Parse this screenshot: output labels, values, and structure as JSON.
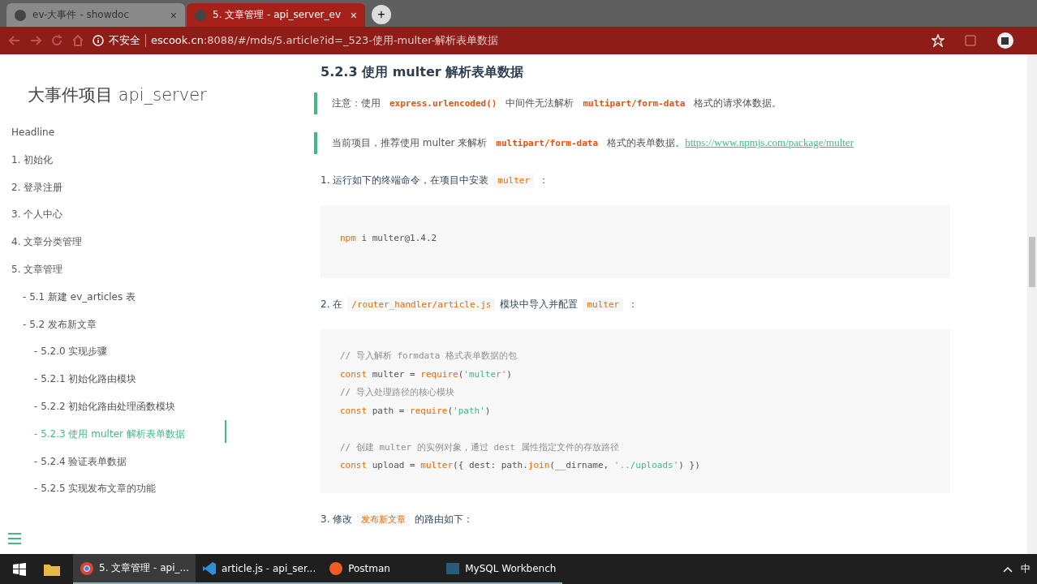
{
  "browser": {
    "tabs": [
      {
        "title": "ev-大事件 - showdoc",
        "selected": false,
        "close": "×"
      },
      {
        "title": "5. 文章管理 - api_server_ev",
        "selected": true,
        "close": "×"
      }
    ],
    "new_tab": "+",
    "security": "不安全",
    "url_host": "escook.cn",
    "url_rest": ":8088/#/mds/5.article?id=_523-使用-multer-解析表单数据"
  },
  "sidebar": {
    "title": "大事件项目 api_server",
    "toc": [
      {
        "label": "Headline",
        "selected": false
      },
      {
        "label": "1. 初始化",
        "selected": false
      },
      {
        "label": "2. 登录注册",
        "selected": false
      },
      {
        "label": "3. 个人中心",
        "selected": false
      },
      {
        "label": "4. 文章分类管理",
        "selected": false
      },
      {
        "label": "5. 文章管理",
        "selected": false,
        "children": [
          {
            "label": "- 5.1 新建 ev_articles 表",
            "selected": false
          },
          {
            "label": "- 5.2 发布新文章",
            "selected": false,
            "children": [
              {
                "label": "- 5.2.0 实现步骤",
                "selected": false
              },
              {
                "label": "- 5.2.1 初始化路由模块",
                "selected": false
              },
              {
                "label": "- 5.2.2 初始化路由处理函数模块",
                "selected": false
              },
              {
                "label": "- 5.2.3 使用 multer 解析表单数据",
                "selected": true
              },
              {
                "label": "- 5.2.4 验证表单数据",
                "selected": false
              },
              {
                "label": "- 5.2.5 实现发布文章的功能",
                "selected": false
              }
            ]
          }
        ]
      }
    ]
  },
  "article": {
    "heading": "5.2.3 使用 multer 解析表单数据",
    "blocks": [
      {
        "kind": "quote",
        "parts": [
          {
            "kind": "text",
            "text": "注意：使用"
          },
          {
            "kind": "code",
            "text": "express.urlencoded()"
          },
          {
            "kind": "text",
            "text": "中间件无法解析"
          },
          {
            "kind": "code",
            "text": "multipart/form-data"
          },
          {
            "kind": "text",
            "text": "格式的请求体数据。"
          }
        ]
      },
      {
        "kind": "quote",
        "parts": [
          {
            "kind": "text",
            "text": "当前项目，推荐使用 multer 来解析"
          },
          {
            "kind": "code",
            "text": "multipart/form-data"
          },
          {
            "kind": "text",
            "text": "格式的表单数据。"
          },
          {
            "kind": "link",
            "text": "https://www.npmjs.com/package/multer"
          }
        ]
      },
      {
        "kind": "para",
        "parts": [
          {
            "kind": "text",
            "text": "1. 运行如下的终端命令，在项目中安装"
          },
          {
            "kind": "code",
            "text": "multer"
          },
          {
            "kind": "text",
            "text": "："
          }
        ]
      },
      {
        "kind": "codeblock",
        "lines": [
          [
            {
              "kind": "keyword",
              "text": "npm"
            },
            {
              "kind": "plain",
              "text": " i multer@1.4.2"
            }
          ]
        ]
      },
      {
        "kind": "para",
        "parts": [
          {
            "kind": "text",
            "text": "2. 在"
          },
          {
            "kind": "code",
            "text": "/router_handler/article.js"
          },
          {
            "kind": "text",
            "text": "模块中导入并配置"
          },
          {
            "kind": "code",
            "text": "multer"
          },
          {
            "kind": "text",
            "text": "："
          }
        ]
      },
      {
        "kind": "codeblock",
        "lines": [
          [
            {
              "kind": "comment",
              "text": "// 导入解析 formdata 格式表单数据的包"
            }
          ],
          [
            {
              "kind": "keyword",
              "text": "const"
            },
            {
              "kind": "plain",
              "text": " multer = "
            },
            {
              "kind": "keyword",
              "text": "require"
            },
            {
              "kind": "plain",
              "text": "("
            },
            {
              "kind": "string",
              "text": "'multer'"
            },
            {
              "kind": "plain",
              "text": ")"
            }
          ],
          [
            {
              "kind": "comment",
              "text": "// 导入处理路径的核心模块"
            }
          ],
          [
            {
              "kind": "keyword",
              "text": "const"
            },
            {
              "kind": "plain",
              "text": " path = "
            },
            {
              "kind": "keyword",
              "text": "require"
            },
            {
              "kind": "plain",
              "text": "("
            },
            {
              "kind": "string",
              "text": "'path'"
            },
            {
              "kind": "plain",
              "text": ")"
            }
          ],
          [
            {
              "kind": "blank"
            }
          ],
          [
            {
              "kind": "comment",
              "text": "// 创建 multer 的实例对象，通过 dest 属性指定文件的存放路径"
            }
          ],
          [
            {
              "kind": "keyword",
              "text": "const"
            },
            {
              "kind": "plain",
              "text": " upload = "
            },
            {
              "kind": "keyword",
              "text": "multer"
            },
            {
              "kind": "plain",
              "text": "({ dest: path."
            },
            {
              "kind": "keyword",
              "text": "join"
            },
            {
              "kind": "plain",
              "text": "(__dirname, "
            },
            {
              "kind": "string",
              "text": "'../uploads'"
            },
            {
              "kind": "plain",
              "text": ") })"
            }
          ]
        ]
      },
      {
        "kind": "para",
        "parts": [
          {
            "kind": "text",
            "text": "3. 修改"
          },
          {
            "kind": "code",
            "text": "发布新文章"
          },
          {
            "kind": "text",
            "text": "的路由如下："
          }
        ]
      }
    ]
  },
  "taskbar": {
    "items": [
      {
        "kind": "chrome",
        "label": "5. 文章管理 - api_..."
      },
      {
        "kind": "vscode",
        "label": "article.js - api_ser..."
      },
      {
        "kind": "postman",
        "label": "Postman"
      },
      {
        "kind": "mysql",
        "label": "MySQL Workbench"
      }
    ],
    "ime": "中"
  }
}
